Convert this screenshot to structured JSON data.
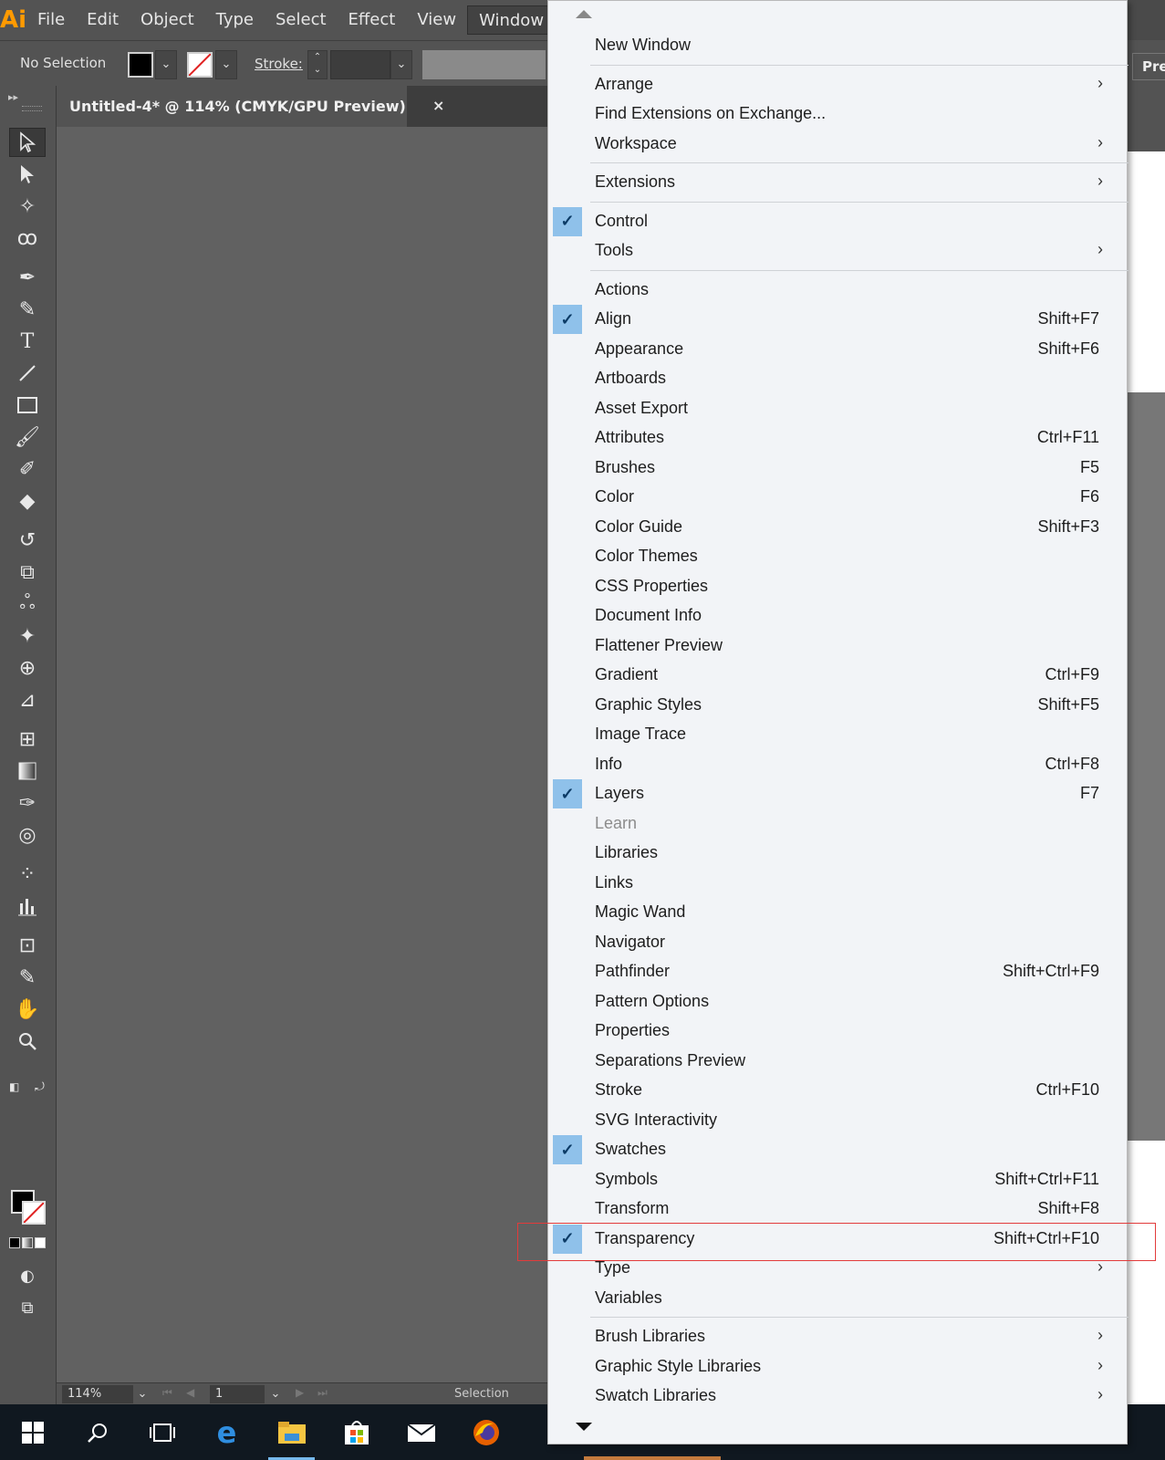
{
  "app": {
    "logo": "Ai",
    "menubar": [
      "File",
      "Edit",
      "Object",
      "Type",
      "Select",
      "Effect",
      "View",
      "Window"
    ],
    "active_menu": "Window"
  },
  "controlbar": {
    "selection_text": "No Selection",
    "stroke_label": "Stroke:",
    "preferences_button": "Pref"
  },
  "document": {
    "tab_title": "Untitled-4* @ 114% (CMYK/GPU Preview)",
    "close_glyph": "×"
  },
  "statusbar": {
    "zoom": "114%",
    "artboard": "1",
    "status_text": "Selection"
  },
  "tools": [
    "selection-tool",
    "direct-selection-tool",
    "magic-wand-tool",
    "lasso-tool",
    "pen-tool",
    "curvature-tool",
    "type-tool",
    "line-segment-tool",
    "rectangle-tool",
    "paintbrush-tool",
    "shaper-tool",
    "eraser-tool",
    "rotate-tool",
    "scale-tool",
    "warp-tool",
    "puppet-warp-tool",
    "shape-builder-tool",
    "perspective-grid-tool",
    "mesh-tool",
    "gradient-tool",
    "eyedropper-tool",
    "blend-tool",
    "symbol-sprayer-tool",
    "column-graph-tool",
    "artboard-tool",
    "slice-tool",
    "hand-tool",
    "zoom-tool"
  ],
  "window_menu": {
    "items": [
      {
        "label": "New Window",
        "shortcut": "",
        "submenu": false,
        "checked": false,
        "disabled": false
      },
      {
        "separator": true
      },
      {
        "label": "Arrange",
        "shortcut": "",
        "submenu": true,
        "checked": false,
        "disabled": false
      },
      {
        "label": "Find Extensions on Exchange...",
        "shortcut": "",
        "submenu": false,
        "checked": false,
        "disabled": false
      },
      {
        "label": "Workspace",
        "shortcut": "",
        "submenu": true,
        "checked": false,
        "disabled": false
      },
      {
        "separator": true
      },
      {
        "label": "Extensions",
        "shortcut": "",
        "submenu": true,
        "checked": false,
        "disabled": false
      },
      {
        "separator": true
      },
      {
        "label": "Control",
        "shortcut": "",
        "submenu": false,
        "checked": true,
        "disabled": false
      },
      {
        "label": "Tools",
        "shortcut": "",
        "submenu": true,
        "checked": false,
        "disabled": false
      },
      {
        "separator": true
      },
      {
        "label": "Actions",
        "shortcut": "",
        "submenu": false,
        "checked": false,
        "disabled": false
      },
      {
        "label": "Align",
        "shortcut": "Shift+F7",
        "submenu": false,
        "checked": true,
        "disabled": false
      },
      {
        "label": "Appearance",
        "shortcut": "Shift+F6",
        "submenu": false,
        "checked": false,
        "disabled": false
      },
      {
        "label": "Artboards",
        "shortcut": "",
        "submenu": false,
        "checked": false,
        "disabled": false
      },
      {
        "label": "Asset Export",
        "shortcut": "",
        "submenu": false,
        "checked": false,
        "disabled": false
      },
      {
        "label": "Attributes",
        "shortcut": "Ctrl+F11",
        "submenu": false,
        "checked": false,
        "disabled": false
      },
      {
        "label": "Brushes",
        "shortcut": "F5",
        "submenu": false,
        "checked": false,
        "disabled": false
      },
      {
        "label": "Color",
        "shortcut": "F6",
        "submenu": false,
        "checked": false,
        "disabled": false
      },
      {
        "label": "Color Guide",
        "shortcut": "Shift+F3",
        "submenu": false,
        "checked": false,
        "disabled": false
      },
      {
        "label": "Color Themes",
        "shortcut": "",
        "submenu": false,
        "checked": false,
        "disabled": false
      },
      {
        "label": "CSS Properties",
        "shortcut": "",
        "submenu": false,
        "checked": false,
        "disabled": false
      },
      {
        "label": "Document Info",
        "shortcut": "",
        "submenu": false,
        "checked": false,
        "disabled": false
      },
      {
        "label": "Flattener Preview",
        "shortcut": "",
        "submenu": false,
        "checked": false,
        "disabled": false
      },
      {
        "label": "Gradient",
        "shortcut": "Ctrl+F9",
        "submenu": false,
        "checked": false,
        "disabled": false
      },
      {
        "label": "Graphic Styles",
        "shortcut": "Shift+F5",
        "submenu": false,
        "checked": false,
        "disabled": false
      },
      {
        "label": "Image Trace",
        "shortcut": "",
        "submenu": false,
        "checked": false,
        "disabled": false
      },
      {
        "label": "Info",
        "shortcut": "Ctrl+F8",
        "submenu": false,
        "checked": false,
        "disabled": false
      },
      {
        "label": "Layers",
        "shortcut": "F7",
        "submenu": false,
        "checked": true,
        "disabled": false
      },
      {
        "label": "Learn",
        "shortcut": "",
        "submenu": false,
        "checked": false,
        "disabled": true
      },
      {
        "label": "Libraries",
        "shortcut": "",
        "submenu": false,
        "checked": false,
        "disabled": false
      },
      {
        "label": "Links",
        "shortcut": "",
        "submenu": false,
        "checked": false,
        "disabled": false
      },
      {
        "label": "Magic Wand",
        "shortcut": "",
        "submenu": false,
        "checked": false,
        "disabled": false
      },
      {
        "label": "Navigator",
        "shortcut": "",
        "submenu": false,
        "checked": false,
        "disabled": false
      },
      {
        "label": "Pathfinder",
        "shortcut": "Shift+Ctrl+F9",
        "submenu": false,
        "checked": false,
        "disabled": false
      },
      {
        "label": "Pattern Options",
        "shortcut": "",
        "submenu": false,
        "checked": false,
        "disabled": false
      },
      {
        "label": "Properties",
        "shortcut": "",
        "submenu": false,
        "checked": false,
        "disabled": false
      },
      {
        "label": "Separations Preview",
        "shortcut": "",
        "submenu": false,
        "checked": false,
        "disabled": false
      },
      {
        "label": "Stroke",
        "shortcut": "Ctrl+F10",
        "submenu": false,
        "checked": false,
        "disabled": false
      },
      {
        "label": "SVG Interactivity",
        "shortcut": "",
        "submenu": false,
        "checked": false,
        "disabled": false
      },
      {
        "label": "Swatches",
        "shortcut": "",
        "submenu": false,
        "checked": true,
        "disabled": false
      },
      {
        "label": "Symbols",
        "shortcut": "Shift+Ctrl+F11",
        "submenu": false,
        "checked": false,
        "disabled": false
      },
      {
        "label": "Transform",
        "shortcut": "Shift+F8",
        "submenu": false,
        "checked": false,
        "disabled": false
      },
      {
        "label": "Transparency",
        "shortcut": "Shift+Ctrl+F10",
        "submenu": false,
        "checked": true,
        "disabled": false,
        "highlighted": true
      },
      {
        "label": "Type",
        "shortcut": "",
        "submenu": true,
        "checked": false,
        "disabled": false
      },
      {
        "label": "Variables",
        "shortcut": "",
        "submenu": false,
        "checked": false,
        "disabled": false
      },
      {
        "separator": true
      },
      {
        "label": "Brush Libraries",
        "shortcut": "",
        "submenu": true,
        "checked": false,
        "disabled": false
      },
      {
        "label": "Graphic Style Libraries",
        "shortcut": "",
        "submenu": true,
        "checked": false,
        "disabled": false
      },
      {
        "label": "Swatch Libraries",
        "shortcut": "",
        "submenu": true,
        "checked": false,
        "disabled": false
      }
    ]
  },
  "taskbar": [
    "windows-start-icon",
    "search-icon",
    "task-view-icon",
    "edge-browser-icon",
    "file-explorer-icon",
    "store-icon",
    "mail-icon",
    "firefox-icon"
  ],
  "colors": {
    "accent_check": "#8fc1ea",
    "highlight_box": "#e23b3b",
    "logo": "#ff9a00"
  }
}
